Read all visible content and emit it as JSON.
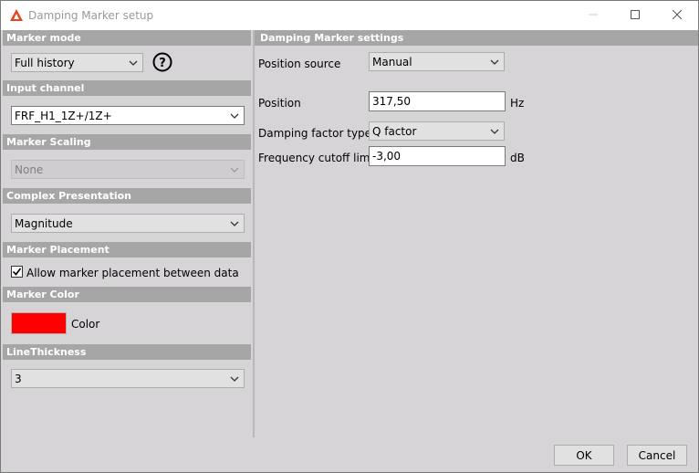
{
  "window": {
    "title": "Damping Marker setup",
    "icons": {
      "app": "app-logo-icon",
      "minimize": "minimize-icon",
      "maximize": "maximize-icon",
      "close": "close-icon"
    }
  },
  "left": {
    "marker_mode": {
      "header": "Marker mode",
      "value": "Full history",
      "help_icon": "help-icon"
    },
    "input_channel": {
      "header": "Input channel",
      "value": "FRF_H1_1Z+/1Z+"
    },
    "marker_scaling": {
      "header": "Marker Scaling",
      "value": "None"
    },
    "complex_presentation": {
      "header": "Complex Presentation",
      "value": "Magnitude"
    },
    "marker_placement": {
      "header": "Marker Placement",
      "checkbox_label": "Allow marker placement between data",
      "checked": true
    },
    "marker_color": {
      "header": "Marker Color",
      "label": "Color",
      "color": "#ff0000"
    },
    "line_thickness": {
      "header": "LineThickness",
      "value": "3"
    }
  },
  "right": {
    "header": "Damping Marker settings",
    "position_source": {
      "label": "Position source",
      "value": "Manual"
    },
    "position": {
      "label": "Position",
      "value": "317,50",
      "unit": "Hz"
    },
    "damping_factor_type": {
      "label": "Damping factor type",
      "value": "Q factor"
    },
    "frequency_cutoff": {
      "label": "Frequency cutoff limit",
      "value": "-3,00",
      "unit": "dB"
    }
  },
  "footer": {
    "ok": "OK",
    "cancel": "Cancel"
  }
}
